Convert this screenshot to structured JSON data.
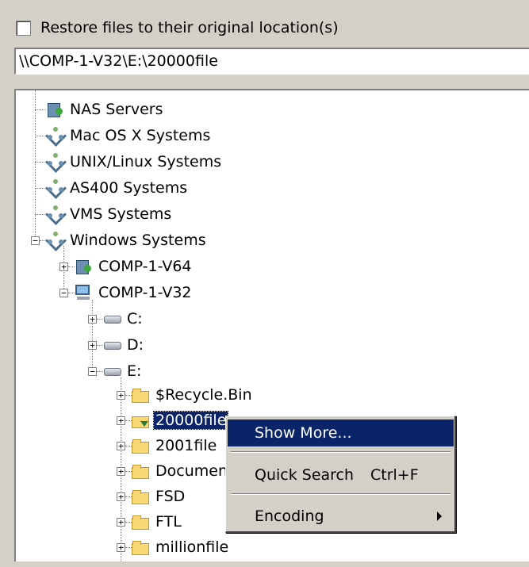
{
  "restore": {
    "checkbox_label": "Restore files to their original location(s)",
    "checked": false
  },
  "path": {
    "value": "\\\\COMP-1-V32\\E:\\20000file"
  },
  "tree": {
    "root_nodes": [
      {
        "label": "NAS Servers",
        "icon": "nas-server-icon"
      },
      {
        "label": "Mac OS X Systems",
        "icon": "network-icon"
      },
      {
        "label": "UNIX/Linux Systems",
        "icon": "network-icon"
      },
      {
        "label": "AS400 Systems",
        "icon": "network-icon"
      },
      {
        "label": "VMS Systems",
        "icon": "network-icon"
      },
      {
        "label": "Windows Systems",
        "icon": "network-icon",
        "expanded": true
      }
    ],
    "computers": [
      {
        "label": "COMP-1-V64",
        "icon": "server-icon",
        "expanded": false
      },
      {
        "label": "COMP-1-V32",
        "icon": "computer-icon",
        "expanded": true
      }
    ],
    "drives": [
      {
        "label": "C:",
        "expanded": false
      },
      {
        "label": "D:",
        "expanded": false
      },
      {
        "label": "E:",
        "expanded": true
      }
    ],
    "folders": [
      {
        "label": "$Recycle.Bin"
      },
      {
        "label": "20000file",
        "selected": true
      },
      {
        "label": "2001file"
      },
      {
        "label": "Documents"
      },
      {
        "label": "FSD"
      },
      {
        "label": "FTL"
      },
      {
        "label": "millionfile"
      }
    ]
  },
  "context_menu": {
    "items": [
      {
        "label": "Show More...",
        "shortcut": "",
        "highlighted": true
      },
      {
        "label": "Quick Search",
        "shortcut": "Ctrl+F"
      },
      {
        "label": "Encoding",
        "shortcut": "",
        "submenu": true
      }
    ]
  },
  "colors": {
    "selection": "#0a246a",
    "window": "#d4d0c8"
  }
}
